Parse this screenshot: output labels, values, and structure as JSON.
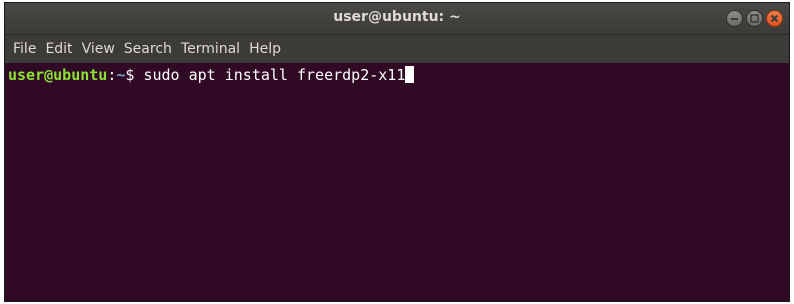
{
  "window": {
    "title": "user@ubuntu: ~"
  },
  "window_controls": {
    "minimize_icon": "minimize-icon",
    "maximize_icon": "maximize-icon",
    "close_icon": "close-icon"
  },
  "menubar": {
    "items": [
      "File",
      "Edit",
      "View",
      "Search",
      "Terminal",
      "Help"
    ]
  },
  "terminal": {
    "prompt_user": "user@ubuntu",
    "prompt_colon": ":",
    "prompt_path": "~",
    "prompt_symbol": "$ ",
    "command": "sudo apt install freerdp2-x11"
  },
  "colors": {
    "terminal_background": "#300a24",
    "titlebar": "#3c3b37",
    "prompt_user": "#8ae234",
    "prompt_path": "#729fcf",
    "close_button": "#e0561f"
  }
}
